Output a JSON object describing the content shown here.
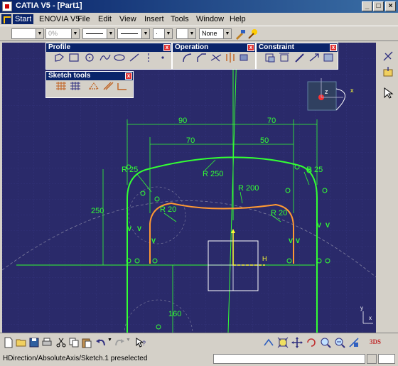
{
  "window": {
    "title": "CATIA V5 - [Part1]"
  },
  "menu": {
    "items": [
      "Start",
      "ENOVIA V5",
      "File",
      "Edit",
      "View",
      "Insert",
      "Tools",
      "Window",
      "Help"
    ]
  },
  "toolbar": {
    "percent_value": "0%",
    "layer_value": "None"
  },
  "panels": {
    "profile_title": "Profile",
    "operation_title": "Operation",
    "constraint_title": "Constraint",
    "sketch_tools_title": "Sketch tools"
  },
  "dimensions": {
    "d90": "90",
    "d70_top": "70",
    "d70_inner": "70",
    "d50": "50",
    "r25_left": "R 25",
    "r25_right": "R 25",
    "r250": "R 250",
    "r200": "R 200",
    "r20_left": "R 20",
    "r20_right": "R 20",
    "d250": "250",
    "d160": "160"
  },
  "axis_labels": {
    "h": "H",
    "v": "V",
    "compass_z": "z",
    "compass_x": "x",
    "corner_y": "y",
    "corner_x": "x"
  },
  "colors": {
    "viewport_bg": "#2a2a6a",
    "constraint_green": "#33ff33",
    "profile_orange": "#ff9933",
    "accent_titlebar": "#0a246a"
  },
  "status": {
    "message": "HDirection/AbsoluteAxis/Sketch.1 preselected"
  }
}
